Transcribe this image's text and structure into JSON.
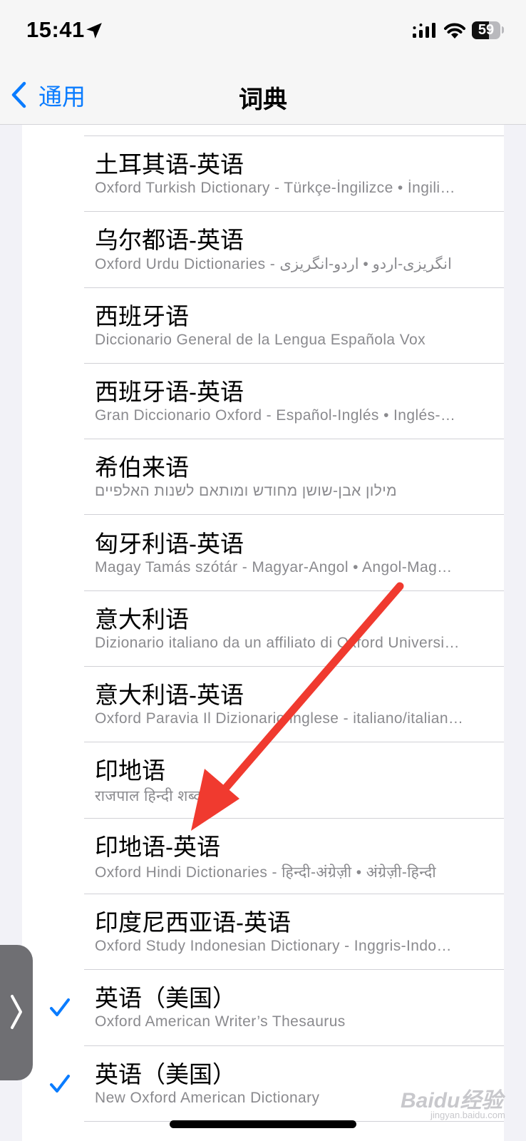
{
  "status_bar": {
    "time": "15:41",
    "battery_text": "59",
    "battery_level": 0.59,
    "icons": [
      "location-arrow-icon",
      "cellular-signal-icon",
      "wifi-icon",
      "battery-icon"
    ]
  },
  "nav": {
    "back_label": "通用",
    "title": "词典"
  },
  "colors": {
    "accent": "#0a7cff",
    "arrow": "#f03a2f",
    "subtitle": "#8a8a8e"
  },
  "dictionaries": [
    {
      "title": "土耳其语-英语",
      "subtitle": "Oxford Turkish Dictionary - Türkçe-İngilizce • İngili…",
      "checked": false
    },
    {
      "title": "乌尔都语-英语",
      "subtitle": "Oxford Urdu Dictionaries - انگریزی-اردو • اردو-انگریزی",
      "checked": false
    },
    {
      "title": "西班牙语",
      "subtitle": "Diccionario General de la Lengua Española Vox",
      "checked": false
    },
    {
      "title": "西班牙语-英语",
      "subtitle": "Gran Diccionario Oxford - Español-Inglés • Inglés-…",
      "checked": false
    },
    {
      "title": "希伯来语",
      "subtitle": "מילון אבן-שושן מחודש ומותאם לשנות האלפיים",
      "checked": false
    },
    {
      "title": "匈牙利语-英语",
      "subtitle": "Magay Tamás szótár - Magyar-Angol • Angol-Mag…",
      "checked": false
    },
    {
      "title": "意大利语",
      "subtitle": "Dizionario italiano da un affiliato di Oxford Universi…",
      "checked": false
    },
    {
      "title": "意大利语-英语",
      "subtitle": "Oxford Paravia Il Dizionario inglese - italiano/italian…",
      "checked": false
    },
    {
      "title": "印地语",
      "subtitle": "राजपाल हिन्दी शब्दकोश",
      "checked": false
    },
    {
      "title": "印地语-英语",
      "subtitle": "Oxford Hindi Dictionaries - हिन्दी-अंग्रेज़ी • अंग्रेज़ी-हिन्दी",
      "checked": false
    },
    {
      "title": "印度尼西亚语-英语",
      "subtitle": "Oxford Study Indonesian Dictionary - Inggris-Indo…",
      "checked": false
    },
    {
      "title": "英语（美国）",
      "subtitle": "Oxford American Writer’s Thesaurus",
      "checked": true
    },
    {
      "title": "英语（美国）",
      "subtitle": "New Oxford American Dictionary",
      "checked": true
    }
  ],
  "watermark": {
    "text": "Baidu经验",
    "subtext": "jingyan.baidu.com"
  }
}
